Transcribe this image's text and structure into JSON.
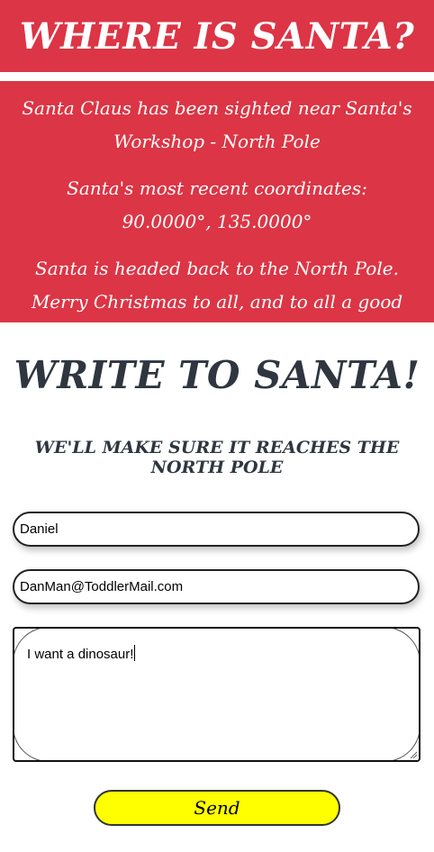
{
  "header": {
    "title": "WHERE IS SANTA?"
  },
  "info": {
    "sighting": "Santa Claus has been sighted near Santa's Workshop - North Pole",
    "coordinates": "Santa's most recent coordinates: 90.0000°, 135.0000°",
    "message": "Santa is headed back to the North Pole. Merry Christmas to all, and to all a good night."
  },
  "letter": {
    "title": "WRITE TO SANTA!",
    "subtitle": "WE'LL MAKE SURE IT REACHES THE NORTH POLE",
    "name_value": "Daniel",
    "email_value": "DanMan@ToddlerMail.com",
    "message_value": "I want a dinosaur!",
    "send_label": "Send"
  },
  "colors": {
    "brand_red": "#dc3545",
    "button_yellow": "#ffff00",
    "heading_dark": "#2f3640"
  }
}
